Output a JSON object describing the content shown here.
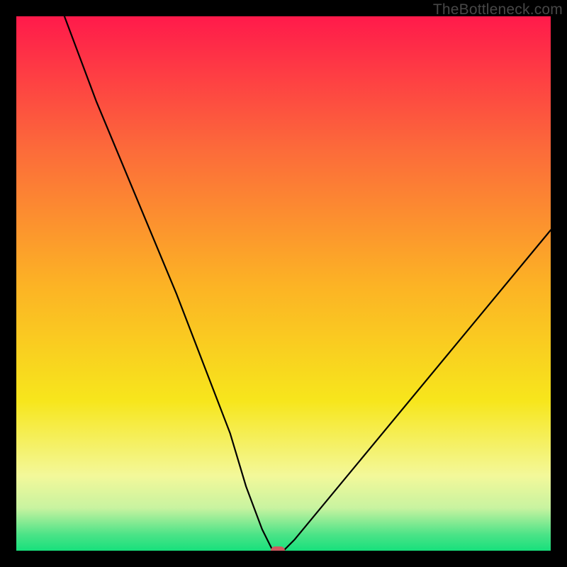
{
  "watermark": "TheBottleneck.com",
  "chart_data": {
    "type": "line",
    "title": "",
    "xlabel": "",
    "ylabel": "",
    "xlim": [
      0,
      100
    ],
    "ylim": [
      0,
      100
    ],
    "grid": false,
    "legend": false,
    "series": [
      {
        "name": "bottleneck-curve",
        "x": [
          9,
          15,
          20,
          25,
          30,
          35,
          40,
          43,
          46,
          48,
          50,
          52,
          100
        ],
        "values": [
          100,
          84,
          72,
          60,
          48,
          35,
          22,
          12,
          4,
          0,
          0,
          2,
          60
        ]
      }
    ],
    "background_gradient": {
      "stops": [
        {
          "offset": 0.0,
          "color": "#ff1a4b"
        },
        {
          "offset": 0.25,
          "color": "#fc6b3a"
        },
        {
          "offset": 0.5,
          "color": "#fcb225"
        },
        {
          "offset": 0.72,
          "color": "#f7e61c"
        },
        {
          "offset": 0.86,
          "color": "#f3f89a"
        },
        {
          "offset": 0.92,
          "color": "#c8f3a0"
        },
        {
          "offset": 0.97,
          "color": "#4be387"
        },
        {
          "offset": 1.0,
          "color": "#17e07c"
        }
      ]
    },
    "marker": {
      "x": 49,
      "y": 0,
      "color": "#cf5a60"
    }
  }
}
